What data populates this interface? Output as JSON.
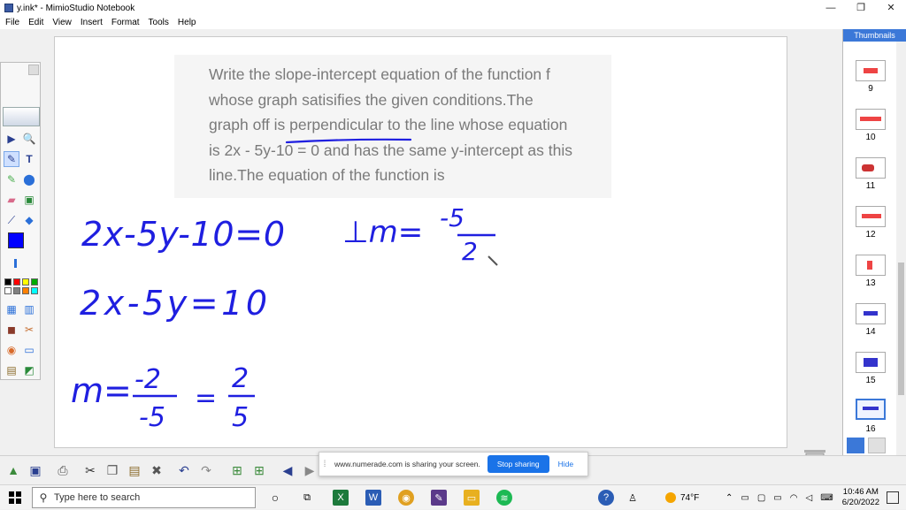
{
  "window": {
    "title": "y.ink* - MimioStudio Notebook",
    "minimize_glyph": "—",
    "restore_glyph": "❐",
    "close_glyph": "✕"
  },
  "menu": [
    "File",
    "Edit",
    "View",
    "Insert",
    "Format",
    "Tools",
    "Help"
  ],
  "question": {
    "lines": [
      "Write the slope-intercept equation of the function f",
      "whose graph satisifies the given conditions.The",
      "graph off is perpendicular to the line whose equation",
      "is 2x - 5y-10 = 0 and has the same y-intercept as this",
      "line.The equation of the function is"
    ]
  },
  "handwriting": {
    "eq1": "2x-5y-10=0",
    "eq2": "2x-5y=10",
    "slope_label": "m=",
    "slope_num": "-2",
    "slope_den": "-5",
    "equals": "=",
    "slope_res_num": "2",
    "slope_res_den": "5",
    "perp_label": "⊥m=",
    "perp_num": "-5",
    "perp_den": "2"
  },
  "colors": {
    "ink": "#1f1fe0",
    "underline": "#1f1fe0",
    "accent": "#3b78d8",
    "stop_sharing": "#1a73e8"
  },
  "thumbnails": {
    "header": "Thumbnails",
    "pages": [
      "9",
      "10",
      "11",
      "12",
      "13",
      "14",
      "15",
      "16"
    ],
    "active": "16"
  },
  "toolbox": {
    "tools": [
      "select-arrow",
      "zoom",
      "pen",
      "text",
      "highlighter",
      "shape",
      "eraser",
      "image",
      "dropper",
      "fill",
      "color",
      "grid",
      "lock",
      "recorder",
      "screen",
      "gallery"
    ],
    "palette": [
      "#000000",
      "#ff0000",
      "#ffff00",
      "#00aa00",
      "#0000ff",
      "#ffffff",
      "#808080",
      "#ff8000",
      "#00ffff",
      "#ff00ff",
      "#804000",
      "#8080ff"
    ]
  },
  "sharebar": {
    "message": "www.numerade.com is sharing your screen.",
    "stop_label": "Stop sharing",
    "hide_label": "Hide"
  },
  "taskbar": {
    "search_placeholder": "Type here to search",
    "weather": "74°F",
    "time": "10:46 AM",
    "date": "6/20/2022"
  }
}
